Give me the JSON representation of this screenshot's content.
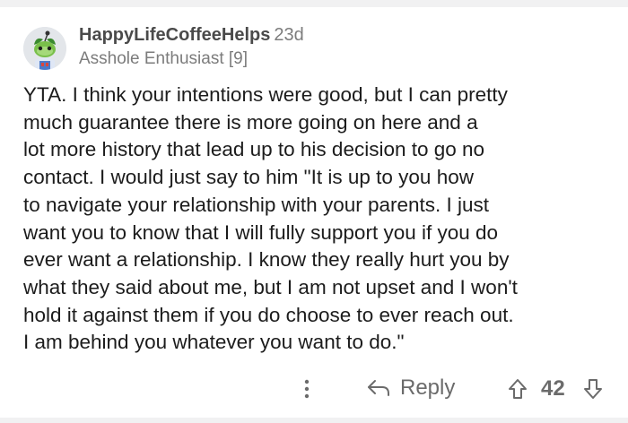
{
  "comment": {
    "username": "HappyLifeCoffeeHelps",
    "age": "23d",
    "flair": "Asshole Enthusiast [9]",
    "body_lines": [
      "YTA.  I think your intentions were good, but I can pretty",
      "much guarantee there is more going on here and a",
      "lot more history that lead up to his decision to go no",
      "contact.  I would just say to him \"It is up to you how",
      "to navigate your relationship with your parents.  I just",
      "want you to know that I will fully support you if you do",
      "ever want a relationship.  I know they really hurt you by",
      "what they said about me, but I am not upset and I won't",
      "hold it against them if you do choose to ever reach out.",
      "I am behind you whatever you want to do.\""
    ]
  },
  "actions": {
    "more_icon": "more-vertical-icon",
    "reply_icon": "reply-arrow-icon",
    "reply_label": "Reply",
    "upvote_icon": "arrow-up-icon",
    "score": "42",
    "downvote_icon": "arrow-down-icon"
  },
  "colors": {
    "background": "#f1f1f2",
    "card": "#ffffff",
    "text": "#1c1c1c",
    "meta": "#7c7c7c",
    "action": "#6b6b6b"
  }
}
